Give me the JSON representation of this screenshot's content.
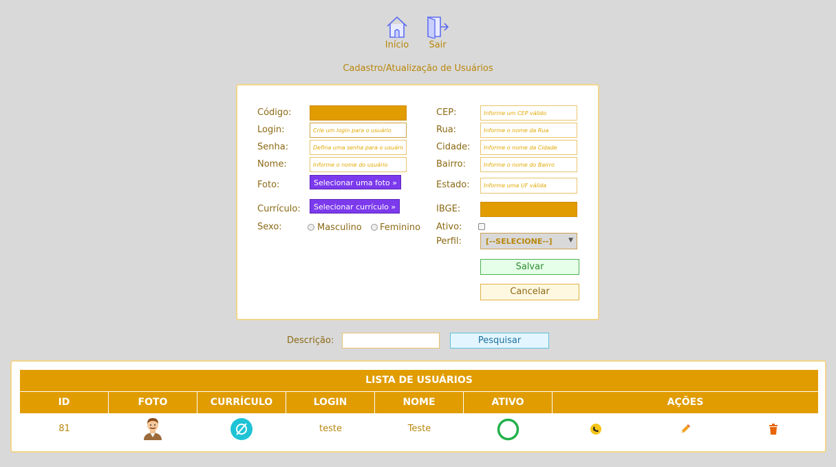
{
  "nav": {
    "home_label": "Início",
    "logout_label": "Sair"
  },
  "page_title": "Cadastro/Atualização de Usuários",
  "form": {
    "codigo_label": "Código:",
    "login_label": "Login:",
    "login_placeholder": "Crie um login para o usuário",
    "senha_label": "Senha:",
    "senha_placeholder": "Defina uma senha para o usuário",
    "nome_label": "Nome:",
    "nome_placeholder": "Informe o nome do usuário",
    "foto_label": "Foto:",
    "foto_button": "Selecionar uma foto »",
    "curriculo_label": "Currículo:",
    "curriculo_button": "Selecionar currículo »",
    "sexo_label": "Sexo:",
    "sexo_options": [
      "Masculino",
      "Feminino"
    ],
    "cep_label": "CEP:",
    "cep_placeholder": "Informe um CEP válido",
    "rua_label": "Rua:",
    "rua_placeholder": "Informe o nome da Rua",
    "cidade_label": "Cidade:",
    "cidade_placeholder": "Informe o nome da Cidade",
    "bairro_label": "Bairro:",
    "bairro_placeholder": "Informe o nome do Bairro",
    "estado_label": "Estado:",
    "estado_placeholder": "Informe uma UF válida",
    "ibge_label": "IBGE:",
    "ativo_label": "Ativo:",
    "perfil_label": "Perfil:",
    "perfil_selected": "[--SELECIONE--]",
    "salvar_label": "Salvar",
    "cancelar_label": "Cancelar"
  },
  "search": {
    "label": "Descrição:",
    "button": "Pesquisar"
  },
  "list": {
    "title": "LISTA DE USUÁRIOS",
    "columns": [
      "ID",
      "FOTO",
      "CURRÍCULO",
      "LOGIN",
      "NOME",
      "ATIVO",
      "AÇÕES"
    ],
    "rows": [
      {
        "id": "81",
        "login": "teste",
        "nome": "Teste"
      }
    ]
  },
  "colors": {
    "accent": "#e09c00",
    "text": "#b8860b",
    "purple_button": "#7c3aed",
    "active_ring": "#22b14c",
    "curriculo_icon": "#1fc3d6",
    "delete_icon": "#e8650a"
  },
  "icons": {
    "home": "home-icon",
    "logout": "door-exit-icon",
    "avatar": "user-avatar-icon",
    "curriculo": "empty-set-icon",
    "ativo": "green-ring-icon",
    "phone": "phone-icon",
    "edit": "pencil-icon",
    "delete": "trash-icon"
  }
}
